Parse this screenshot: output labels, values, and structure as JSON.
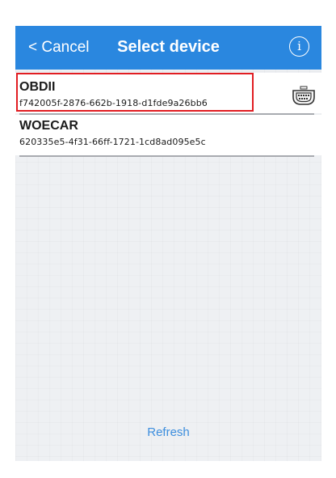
{
  "header": {
    "cancel_label": "< Cancel",
    "title": "Select device",
    "info_icon": "info-icon",
    "info_symbol": "i"
  },
  "devices": [
    {
      "name": "OBDII",
      "id": "f742005f-2876-662b-1918-d1fde9a26bb6",
      "icon": "obd-connector-icon",
      "highlighted": true
    },
    {
      "name": "WOECAR",
      "id": "620335e5-4f31-66ff-1721-1cd8ad095e5c"
    }
  ],
  "footer": {
    "refresh_label": "Refresh"
  },
  "colors": {
    "header_bg": "#2a87df",
    "highlight_border": "#e11d22",
    "refresh_text": "#3d8ede"
  }
}
